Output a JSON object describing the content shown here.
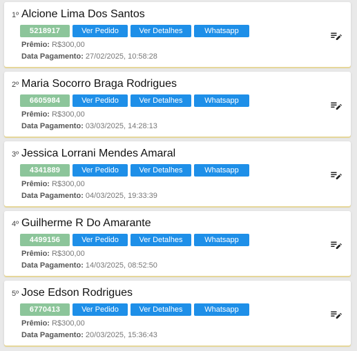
{
  "labels": {
    "ver_pedido": "Ver Pedido",
    "ver_detalhes": "Ver Detalhes",
    "whatsapp": "Whatsapp",
    "premio": "Prêmio:",
    "data_pagamento": "Data Pagamento:"
  },
  "colors": {
    "action_button": "#1e8fe8",
    "code_badge": "#8cc59a",
    "card_border": "#e6d79a"
  },
  "icons": {
    "edit": "edit-list-icon"
  },
  "winners": [
    {
      "rank": "1º",
      "name": "Alcione Lima Dos Santos",
      "code": "5218917",
      "premio": "R$300,00",
      "data_pagamento": "27/02/2025, 10:58:28"
    },
    {
      "rank": "2º",
      "name": "Maria Socorro Braga Rodrigues",
      "code": "6605984",
      "premio": "R$300,00",
      "data_pagamento": "03/03/2025, 14:28:13"
    },
    {
      "rank": "3º",
      "name": "Jessica Lorrani Mendes Amaral",
      "code": "4341889",
      "premio": "R$300,00",
      "data_pagamento": "04/03/2025, 19:33:39"
    },
    {
      "rank": "4º",
      "name": "Guilherme R Do Amarante",
      "code": "4499156",
      "premio": "R$300,00",
      "data_pagamento": "14/03/2025, 08:52:50"
    },
    {
      "rank": "5º",
      "name": "Jose Edson Rodrigues",
      "code": "6770413",
      "premio": "R$300,00",
      "data_pagamento": "20/03/2025, 15:36:43"
    }
  ]
}
